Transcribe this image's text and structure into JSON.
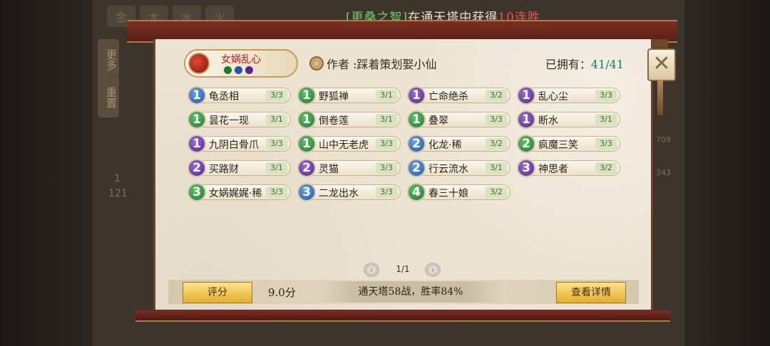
{
  "banner": {
    "prefix": "[",
    "name": "更桑之智",
    "suffix": "]",
    "text": "在通天塔中获得",
    "streak": "10连胜"
  },
  "background": {
    "tabs": [
      "金",
      "木",
      "水",
      "火"
    ],
    "side_buttons": [
      "更多",
      "重置"
    ],
    "numbers": [
      "1",
      "121",
      "709",
      "343"
    ]
  },
  "deck": {
    "name": "女娲乱心",
    "author_label": "作者",
    "author_sep": ":",
    "author": "踩着策划娶小仙",
    "owned_label": "已拥有：",
    "owned_value": "41/41"
  },
  "cards": [
    {
      "cost": "1",
      "color": "blue",
      "name": "龟丞相",
      "count": "3/3"
    },
    {
      "cost": "1",
      "color": "green",
      "name": "野狐禅",
      "count": "3/1"
    },
    {
      "cost": "1",
      "color": "purple",
      "name": "亡命绝杀",
      "count": "3/2"
    },
    {
      "cost": "1",
      "color": "purple",
      "name": "乱心尘",
      "count": "3/3"
    },
    {
      "cost": "1",
      "color": "green",
      "name": "昙花一现",
      "count": "3/1"
    },
    {
      "cost": "1",
      "color": "green",
      "name": "倒卷莲",
      "count": "3/1"
    },
    {
      "cost": "1",
      "color": "green",
      "name": "叠翠",
      "count": "3/3"
    },
    {
      "cost": "1",
      "color": "purple",
      "name": "断水",
      "count": "3/1"
    },
    {
      "cost": "1",
      "color": "purple",
      "name": "九阴白骨爪",
      "count": "3/3"
    },
    {
      "cost": "1",
      "color": "green",
      "name": "山中无老虎",
      "count": "3/3"
    },
    {
      "cost": "2",
      "color": "blue",
      "name": "化龙·稀",
      "count": "3/2"
    },
    {
      "cost": "2",
      "color": "green",
      "name": "疯魔三笑",
      "count": "3/3"
    },
    {
      "cost": "2",
      "color": "purple",
      "name": "买路财",
      "count": "3/1"
    },
    {
      "cost": "2",
      "color": "purple",
      "name": "灵猫",
      "count": "3/3"
    },
    {
      "cost": "2",
      "color": "blue",
      "name": "行云流水",
      "count": "3/1"
    },
    {
      "cost": "3",
      "color": "purple",
      "name": "神思者",
      "count": "3/2"
    },
    {
      "cost": "3",
      "color": "green",
      "name": "女娲娓娓·稀",
      "count": "3/3"
    },
    {
      "cost": "3",
      "color": "blue",
      "name": "二龙出水",
      "count": "3/3"
    },
    {
      "cost": "4",
      "color": "green",
      "name": "春三十娘",
      "count": "3/2"
    }
  ],
  "pager": {
    "text": "1/1",
    "prev": "‹",
    "next": "›"
  },
  "bottom": {
    "rate_button": "评分",
    "score": "9.0分",
    "stats": "通天塔58战，胜率84%",
    "details_button": "查看详情"
  },
  "close_label": "✕",
  "colors": {
    "blue": "#2356a3",
    "green": "#1f7a32",
    "purple": "#53278f",
    "gold": "#e4ad2f",
    "deck_red": "#b31d1d"
  },
  "icons": {
    "avatar": "deck-avatar-icon",
    "author": "magnifier-icon",
    "close": "close-icon"
  }
}
